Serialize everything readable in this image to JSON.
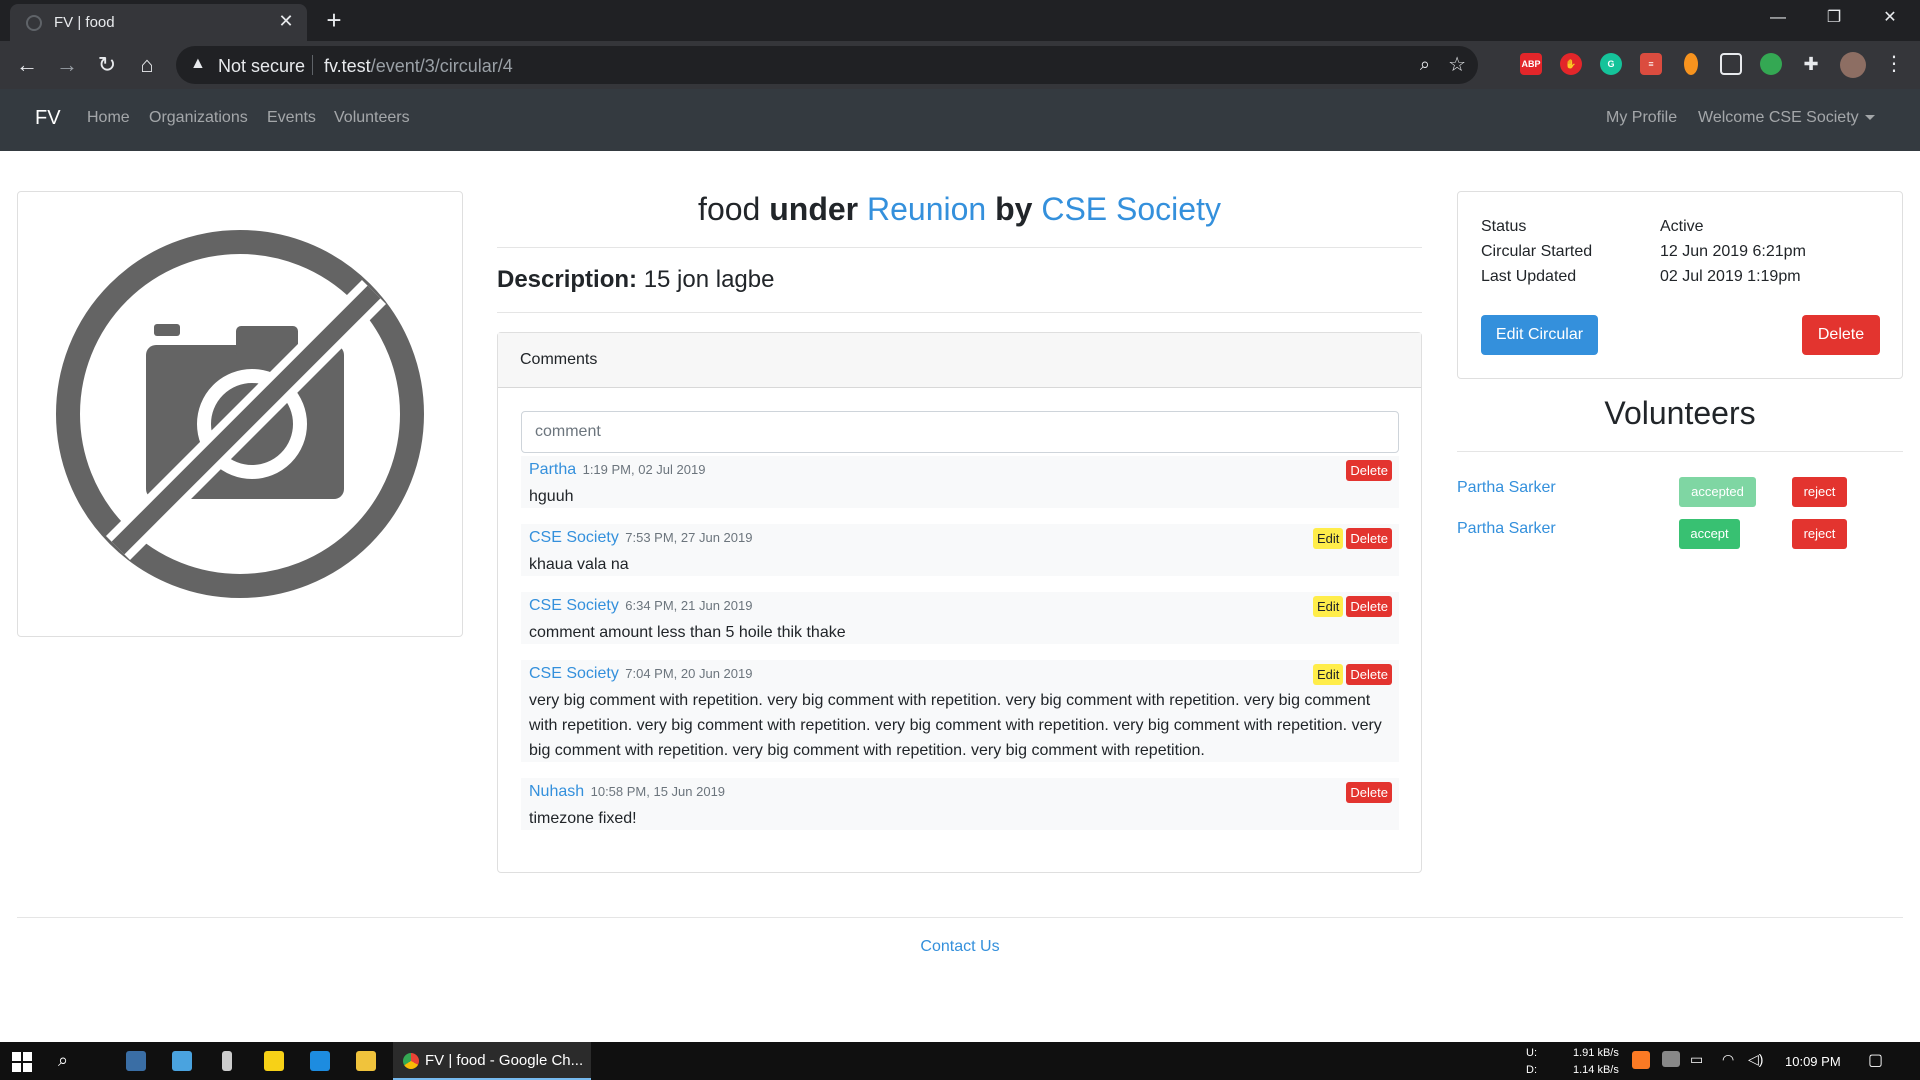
{
  "browser": {
    "tab_title": "FV | food",
    "not_secure": "Not secure",
    "url_host": "fv.test",
    "url_path": "/event/3/circular/4"
  },
  "navbar": {
    "brand": "FV",
    "links": [
      "Home",
      "Organizations",
      "Events",
      "Volunteers"
    ],
    "my_profile": "My Profile",
    "welcome": "Welcome CSE Society"
  },
  "circular": {
    "name": "food",
    "under_word": "under",
    "event": "Reunion",
    "by_word": "by",
    "organization": "CSE Society",
    "description_label": "Description:",
    "description": "15 jon lagbe"
  },
  "comments": {
    "header": "Comments",
    "placeholder": "comment",
    "items": [
      {
        "author": "Partha",
        "time": "1:19 PM, 02 Jul 2019",
        "text": "hguuh",
        "edit": "",
        "delete": "Delete"
      },
      {
        "author": "CSE Society",
        "time": "7:53 PM, 27 Jun 2019",
        "text": "khaua vala na",
        "edit": "Edit",
        "delete": "Delete"
      },
      {
        "author": "CSE Society",
        "time": "6:34 PM, 21 Jun 2019",
        "text": "comment amount less than 5 hoile thik thake",
        "edit": "Edit",
        "delete": "Delete"
      },
      {
        "author": "CSE Society",
        "time": "7:04 PM, 20 Jun 2019",
        "text": "very big comment with repetition. very big comment with repetition. very big comment with repetition. very big comment with repetition. very big comment with repetition. very big comment with repetition. very big comment with repetition. very big comment with repetition. very big comment with repetition. very big comment with repetition.",
        "edit": "Edit",
        "delete": "Delete"
      },
      {
        "author": "Nuhash",
        "time": "10:58 PM, 15 Jun 2019",
        "text": "timezone fixed!",
        "edit": "",
        "delete": "Delete"
      }
    ]
  },
  "info": {
    "status_label": "Status",
    "status_value": "Active",
    "started_label": "Circular Started",
    "started_value": "12 Jun 2019 6:21pm",
    "updated_label": "Last Updated",
    "updated_value": "02 Jul 2019 1:19pm",
    "edit_button": "Edit Circular",
    "delete_button": "Delete"
  },
  "volunteers": {
    "title": "Volunteers",
    "items": [
      {
        "name": "Partha Sarker",
        "status_button": "accepted",
        "reject_button": "reject"
      },
      {
        "name": "Partha Sarker",
        "status_button": "accept",
        "reject_button": "reject"
      }
    ]
  },
  "footer": {
    "contact": "Contact Us"
  },
  "taskbar": {
    "app_label": "FV | food - Google Ch...",
    "net_up_label": "U:",
    "net_up": "1.91 kB/s",
    "net_down_label": "D:",
    "net_down": "1.14 kB/s",
    "clock": "10:09 PM"
  },
  "colors": {
    "primary": "#3490dc",
    "danger": "#e3342f",
    "warning": "#ffed4a",
    "success": "#38c172",
    "navbar": "#343a40"
  }
}
